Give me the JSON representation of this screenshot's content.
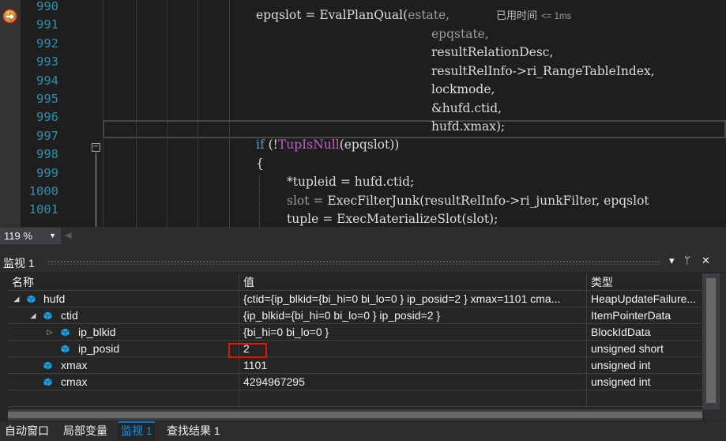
{
  "editor": {
    "line_numbers": [
      "990",
      "991",
      "992",
      "993",
      "994",
      "995",
      "996",
      "997",
      "998",
      "999",
      "1000",
      "1001"
    ],
    "perf_tip_label": "已用时间",
    "perf_tip_value": "<= 1ms",
    "fold_toggle": "−",
    "code": {
      "l990_a": "epqslot = ",
      "l990_fn": "EvalPlanQual",
      "l990_b": "(",
      "l990_arg": "estate,",
      "l991": "epqstate,",
      "l992": "resultRelationDesc,",
      "l993": "resultRelInfo->ri_RangeTableIndex,",
      "l994": "lockmode,",
      "l995": "&hufd.ctid,",
      "l996": "hufd.xmax);",
      "l997_kw": "if",
      "l997_a": " (!",
      "l997_mac": "TupIsNull",
      "l997_b": "(epqslot))",
      "l998": "{",
      "l999": "*tupleid = hufd.ctid;",
      "l1000_a": "slot = ",
      "l1000_fn": "ExecFilterJunk",
      "l1000_b": "(resultRelInfo->ri_junkFilter, epqslot",
      "l1001_a": "tuple = ",
      "l1001_fn": "ExecMaterializeSlot",
      "l1001_b": "(slot);"
    }
  },
  "zoom": {
    "level": "119 %"
  },
  "watch": {
    "title": "监视 1",
    "buttons": {
      "dropdown": "▾",
      "pin": "ᛘ",
      "close": "✕"
    },
    "headers": {
      "name": "名称",
      "value": "值",
      "type": "类型"
    },
    "rows": [
      {
        "name": "hufd",
        "value": "{ctid={ip_blkid={bi_hi=0 bi_lo=0 } ip_posid=2 } xmax=1101 cma...",
        "type": "HeapUpdateFailure..."
      },
      {
        "name": "ctid",
        "value": "{ip_blkid={bi_hi=0 bi_lo=0 } ip_posid=2 }",
        "type": "ItemPointerData"
      },
      {
        "name": "ip_blkid",
        "value": "{bi_hi=0 bi_lo=0 }",
        "type": "BlockIdData"
      },
      {
        "name": "ip_posid",
        "value": "2",
        "type": "unsigned short"
      },
      {
        "name": "xmax",
        "value": "1101",
        "type": "unsigned int"
      },
      {
        "name": "cmax",
        "value": "4294967295",
        "type": "unsigned int"
      }
    ]
  },
  "tabs": [
    {
      "label": "自动窗口",
      "active": false
    },
    {
      "label": "局部变量",
      "active": false
    },
    {
      "label": "监视 1",
      "active": true
    },
    {
      "label": "查找结果 1",
      "active": false
    }
  ],
  "colors": {
    "accent": "#007acc",
    "highlight": "#e51400",
    "line_number": "#2b91af",
    "keyword": "#569cd6",
    "macro": "#bd63c5"
  }
}
